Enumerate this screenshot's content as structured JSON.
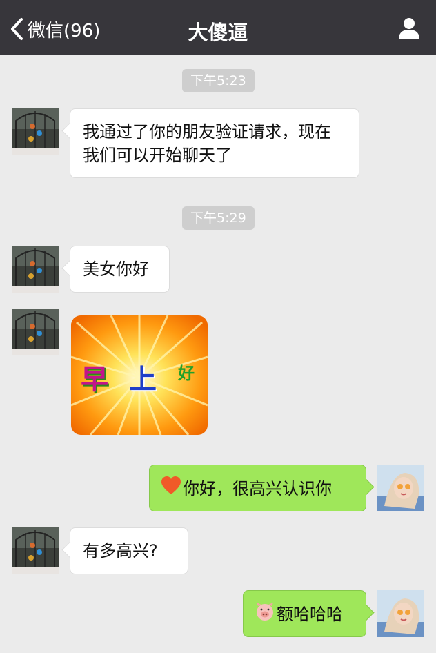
{
  "navbar": {
    "back_label": "微信(96)",
    "title": "大傻逼"
  },
  "messages": {
    "ts1": "下午5:23",
    "m1": "我通过了你的朋友验证请求，现在我们可以开始聊天了",
    "ts2": "下午5:29",
    "m2": "美女你好",
    "sticker": {
      "t1": "早",
      "t2": "上",
      "t3": "好"
    },
    "m4": "你好，很高兴认识你",
    "m5": "有多高兴?",
    "m6": "额哈哈哈"
  },
  "icons": {
    "back": "chevron-left-icon",
    "profile": "person-icon",
    "heart": "heart-emoji-icon",
    "pig": "pig-emoji-icon"
  },
  "colors": {
    "navbar": "#37363b",
    "background": "#ebebeb",
    "bubble_self": "#9fe75a",
    "bubble_other": "#ffffff",
    "timestamp": "#cecece"
  }
}
